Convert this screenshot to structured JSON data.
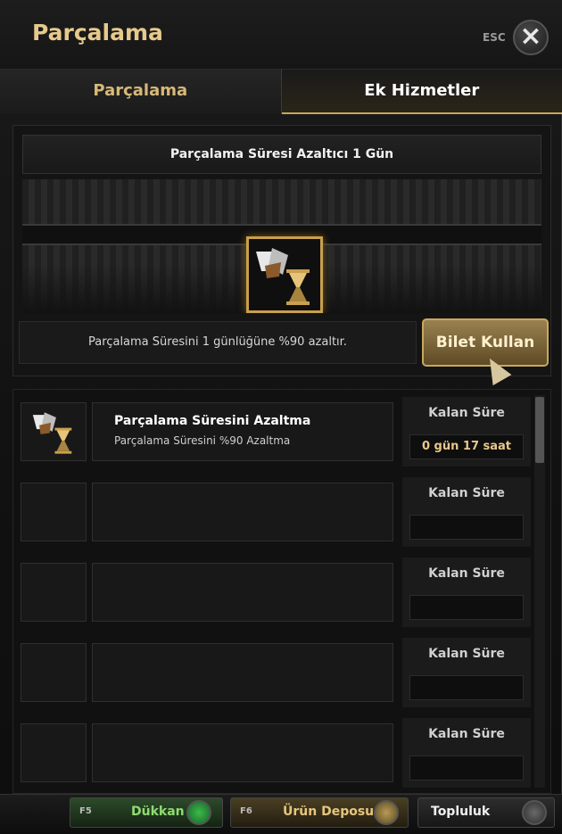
{
  "window": {
    "title": "Parçalama",
    "esc_label": "ESC"
  },
  "tabs": [
    {
      "label": "Parçalama",
      "active": false
    },
    {
      "label": "Ek Hizmetler",
      "active": true
    }
  ],
  "item_panel": {
    "item_name": "Parçalama Süresi Azaltıcı 1 Gün",
    "description": "Parçalama Süresini 1 günlüğüne %90 azaltır.",
    "use_button_label": "Bilet Kullan"
  },
  "active_services": [
    {
      "name": "Parçalama Süresini Azaltma",
      "description": "Parçalama Süresini %90 Azaltma",
      "time_label": "Kalan Süre",
      "time_value": "0 gün 17 saat"
    },
    {
      "name": "",
      "description": "",
      "time_label": "Kalan Süre",
      "time_value": ""
    },
    {
      "name": "",
      "description": "",
      "time_label": "Kalan Süre",
      "time_value": ""
    },
    {
      "name": "",
      "description": "",
      "time_label": "Kalan Süre",
      "time_value": ""
    },
    {
      "name": "",
      "description": "",
      "time_label": "Kalan Süre",
      "time_value": ""
    }
  ],
  "bottom_bar": {
    "shop": {
      "key": "F5",
      "label": "Dükkan"
    },
    "storage": {
      "key": "F6",
      "label": "Ürün Deposu"
    },
    "community": {
      "label": "Topluluk"
    }
  },
  "colors": {
    "gold_accent": "#c9a55e",
    "title_gold": "#e7c98d",
    "shop_green": "#8fdb71"
  }
}
